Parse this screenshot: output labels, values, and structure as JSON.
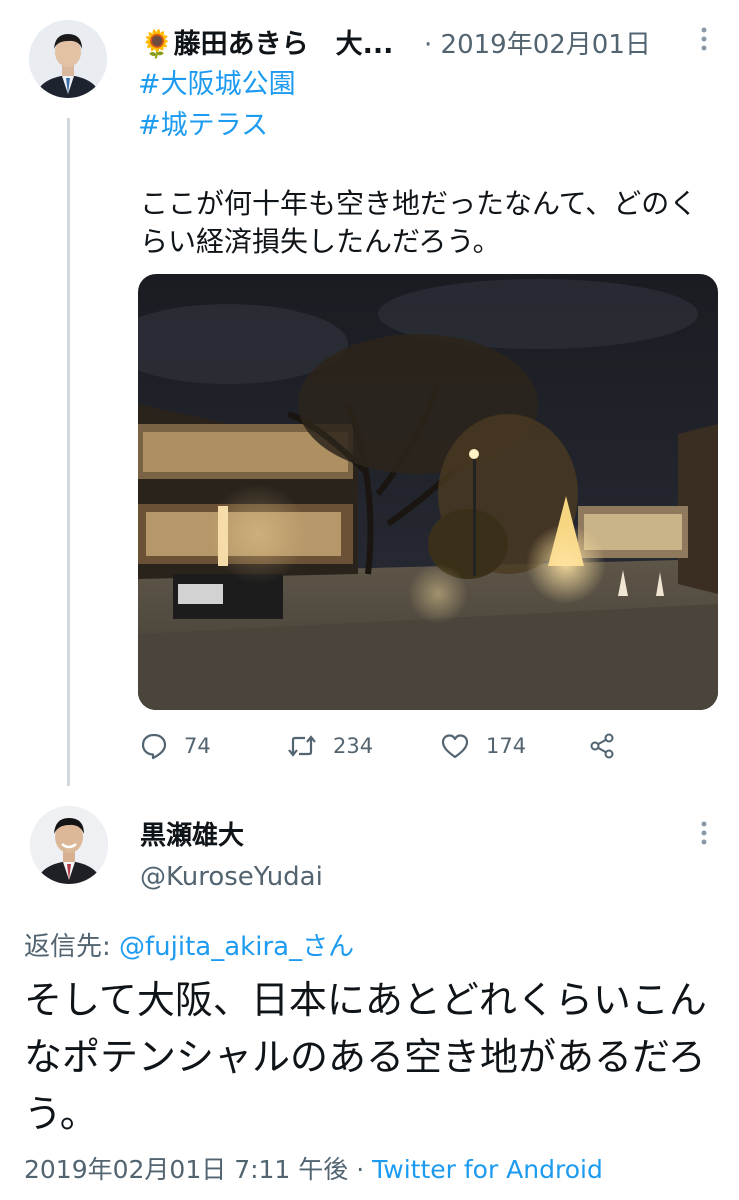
{
  "tweet1": {
    "display_name": "🌻藤田あきら　大...",
    "date": "· 2019年02月01日",
    "hashtags": [
      "#大阪城公園",
      "#城テラス"
    ],
    "text": "ここが何十年も空き地だったなんて、どのくらい経済損失したんだろう。",
    "actions": {
      "replies": "74",
      "retweets": "234",
      "likes": "174"
    }
  },
  "tweet2": {
    "display_name": "黒瀬雄大",
    "handle": "@KuroseYudai",
    "reply_prefix": "返信先: ",
    "reply_to": "@fujita_akira_さん",
    "text": "そして大阪、日本にあとどれくらいこんなポテンシャルのある空き地があるだろう。",
    "timestamp": "2019年02月01日 7:11 午後 · ",
    "source": "Twitter for Android"
  },
  "icons": {
    "more": "vertical-dots-icon",
    "reply": "speech-bubble-icon",
    "retweet": "retweet-arrows-icon",
    "like": "heart-icon",
    "share": "share-icon"
  },
  "colors": {
    "link": "#1d9bf0",
    "muted": "#536471"
  }
}
